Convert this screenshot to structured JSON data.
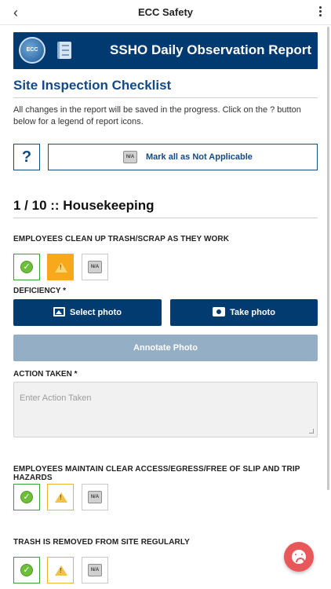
{
  "topbar": {
    "back_icon": "chevron-left-icon",
    "title": "ECC Safety",
    "menu_icon": "more-vertical-icon"
  },
  "banner": {
    "title": "SSHO Daily Observation Report",
    "logo_icon": "ecc-globe-logo-icon",
    "notebook_icon": "notebook-icon",
    "color": "#003a70"
  },
  "checklist": {
    "title": "Site Inspection Checklist",
    "intro": "All changes in the report will be saved in the progress. Click on the ? button below for a legend of report icons.",
    "help_button": "?",
    "mark_all_label": "Mark all as Not Applicable",
    "na_icon_text": "N/A"
  },
  "section": {
    "heading": "1 / 10 :: Housekeeping"
  },
  "questions": [
    {
      "label": "EMPLOYEES CLEAN UP TRASH/SCRAP AS THEY WORK",
      "selected": "deficiency"
    },
    {
      "label": "EMPLOYEES MAINTAIN CLEAR ACCESS/EGRESS/FREE OF SLIP AND TRIP HAZARDS",
      "selected": "none"
    },
    {
      "label": "TRASH IS REMOVED FROM SITE REGULARLY",
      "selected": "none"
    }
  ],
  "deficiency": {
    "label": "DEFICIENCY *",
    "select_photo": "Select photo",
    "take_photo": "Take photo",
    "annotate_photo": "Annotate Photo",
    "action_label": "ACTION TAKEN *",
    "action_placeholder": "Enter Action Taken"
  },
  "colors": {
    "accent": "#134a86",
    "button_dark": "#013b70",
    "button_disabled": "#94aec6",
    "ok_green": "#36a336",
    "warn_orange": "#f7a81b",
    "fab_red": "#e8575a"
  },
  "fab": {
    "icon": "sad-face-icon"
  }
}
